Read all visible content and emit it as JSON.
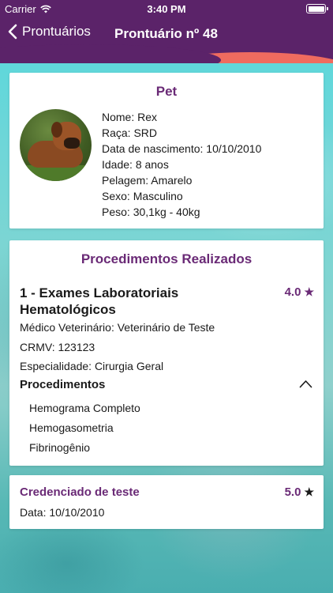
{
  "status_bar": {
    "carrier": "Carrier",
    "time": "3:40 PM"
  },
  "nav": {
    "back_label": "Prontuários",
    "title": "Prontuário nº 48"
  },
  "pet": {
    "title": "Pet",
    "fields": [
      "Nome: Rex",
      "Raça: SRD",
      "Data de nascimento: 10/10/2010",
      "Idade: 8 anos",
      "Pelagem: Amarelo",
      "Sexo: Masculino",
      "Peso: 30,1kg - 40kg"
    ]
  },
  "procedures_card": {
    "title": "Procedimentos Realizados",
    "exam_name": "1 - Exames Laboratoriais Hematológicos",
    "rating": "4.0",
    "vet": "Médico Veterinário: Veterinário de Teste",
    "crmv": "CRMV: 123123",
    "specialty": "Especialidade: Cirurgia Geral",
    "procedures_label": "Procedimentos",
    "procedures": [
      "Hemograma Completo",
      "Hemogasometria",
      "Fibrinogênio"
    ]
  },
  "partner": {
    "name": "Credenciado de teste",
    "rating": "5.0",
    "date": "Data: 10/10/2010"
  },
  "icons": {
    "back": "chevron-left-icon",
    "star": "star-icon",
    "collapse": "chevron-up-icon",
    "wifi": "wifi-icon",
    "battery": "battery-icon"
  },
  "colors": {
    "header": "#5b2369",
    "accent": "#6a2a76",
    "wave": "#ef6b5f"
  }
}
